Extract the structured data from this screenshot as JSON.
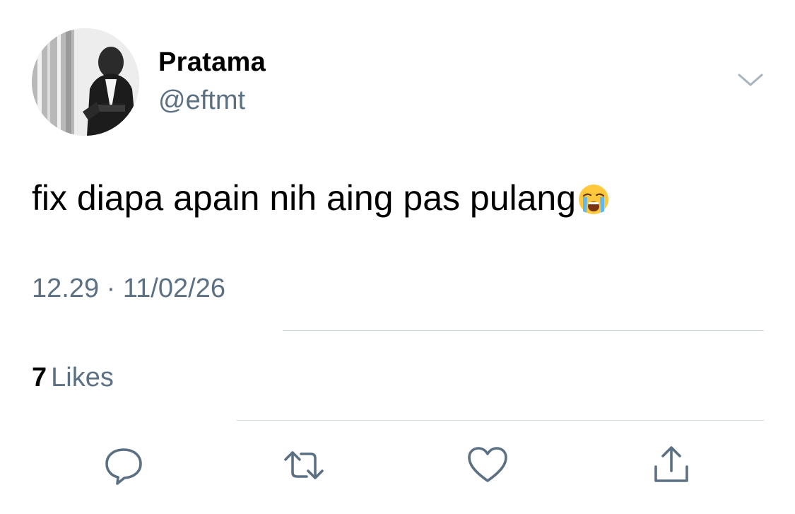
{
  "author": {
    "display_name": "Pratama",
    "handle": "@eftmt"
  },
  "tweet": {
    "text": "fix diapa apain nih aing pas pulang",
    "emoji": "loudly-crying-face"
  },
  "meta": {
    "timestamp": "12.29 · 11/02/26"
  },
  "stats": {
    "likes_count": "7",
    "likes_label": "Likes"
  },
  "actions": {
    "reply_icon": "reply-icon",
    "retweet_icon": "retweet-icon",
    "like_icon": "heart-icon",
    "share_icon": "share-icon"
  },
  "colors": {
    "secondary_text": "#5b7083",
    "divider": "#cfd9de",
    "icon": "#5b7083"
  }
}
